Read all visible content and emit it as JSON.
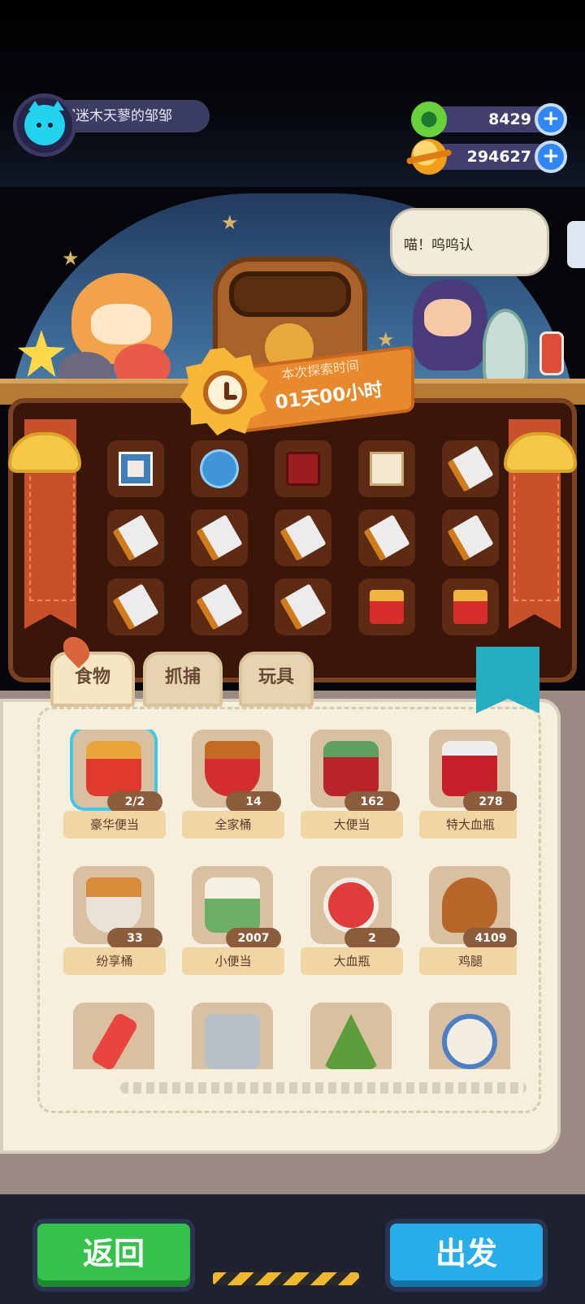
{
  "player": {
    "name": "沉迷木天蓼的邹邹",
    "avatar_icon": "cat-face-icon"
  },
  "currencies": [
    {
      "icon": "donut-coin-icon",
      "value": "8429"
    },
    {
      "icon": "planet-coin-icon",
      "value": "294627"
    }
  ],
  "speech_bubble": "喵！呜呜认",
  "timer": {
    "label": "本次探索时间",
    "value": "01天00小时"
  },
  "reward_items": [
    "photo-card-icon",
    "blue-skull-icon",
    "red-giftbox-icon",
    "certificate-icon",
    "scroll-paper-icon",
    "scroll-paper-icon",
    "scroll-paper-icon",
    "scroll-paper-icon",
    "scroll-paper-icon",
    "scroll-paper-icon",
    "scroll-paper-icon",
    "scroll-paper-icon",
    "scroll-paper-icon",
    "bento-box-icon",
    "bento-box-icon"
  ],
  "tabs": [
    {
      "label": "食物",
      "active": true
    },
    {
      "label": "抓捕",
      "active": false
    },
    {
      "label": "玩具",
      "active": false
    }
  ],
  "food_items": [
    {
      "label": "豪华便当",
      "count": "2/2",
      "icon": "bento",
      "selected": true
    },
    {
      "label": "全家桶",
      "count": "14",
      "icon": "bucket"
    },
    {
      "label": "大便当",
      "count": "162",
      "icon": "big"
    },
    {
      "label": "特大血瓶",
      "count": "278",
      "icon": "bottleXL"
    },
    {
      "label": "纷享桶",
      "count": "33",
      "icon": "share"
    },
    {
      "label": "小便当",
      "count": "2007",
      "icon": "small"
    },
    {
      "label": "大血瓶",
      "count": "2",
      "icon": "potion"
    },
    {
      "label": "鸡腿",
      "count": "4109",
      "icon": "leg"
    },
    {
      "label": "",
      "count": "",
      "icon": "vial"
    },
    {
      "label": "",
      "count": "",
      "icon": "can"
    },
    {
      "label": "",
      "count": "",
      "icon": "zongzi"
    },
    {
      "label": "",
      "count": "",
      "icon": "rice"
    }
  ],
  "buttons": {
    "back": "返回",
    "go": "出发"
  }
}
